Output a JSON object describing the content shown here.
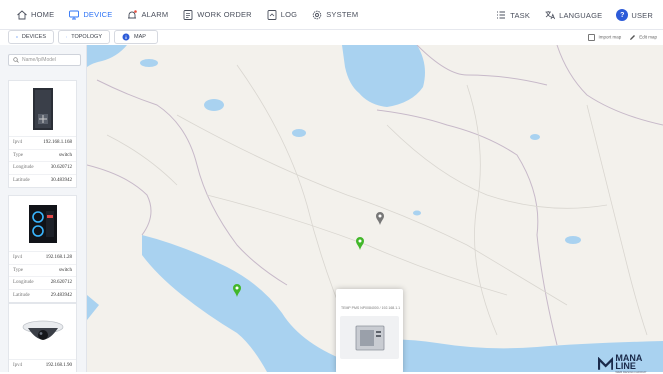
{
  "nav": {
    "items": [
      {
        "label": "HOME",
        "icon": "home-icon",
        "active": false
      },
      {
        "label": "DEVICE",
        "icon": "device-icon",
        "active": true
      },
      {
        "label": "ALARM",
        "icon": "alarm-icon",
        "active": false
      },
      {
        "label": "WORK ORDER",
        "icon": "work-order-icon",
        "active": false
      },
      {
        "label": "LOG",
        "icon": "log-icon",
        "active": false
      },
      {
        "label": "SYSTEM",
        "icon": "system-icon",
        "active": false
      }
    ],
    "right": {
      "task": "TASK",
      "language": "LANGUAGE",
      "user": "USER"
    },
    "accent": "#2d73f5"
  },
  "subtabs": {
    "devices": "DEVICES",
    "topology": "TOPOLOGY",
    "map": "MAP"
  },
  "map_tools": {
    "import": "Import map",
    "edit": "Edit map"
  },
  "search": {
    "placeholder": "Name/Ip/Model"
  },
  "devices": [
    {
      "rows": [
        {
          "k": "Ipv4",
          "v": "192.168.1.168"
        },
        {
          "k": "Type",
          "v": "switch"
        },
        {
          "k": "Longitude",
          "v": "30.620712"
        },
        {
          "k": "Latitude",
          "v": "30.483942"
        }
      ]
    },
    {
      "rows": [
        {
          "k": "Ipv4",
          "v": "192.168.1.28"
        },
        {
          "k": "Type",
          "v": "switch"
        },
        {
          "k": "Longitude",
          "v": "28.620712"
        },
        {
          "k": "Latitude",
          "v": "29.483942"
        }
      ]
    },
    {
      "rows": [
        {
          "k": "Ipv4",
          "v": "192.168.1.90"
        }
      ]
    }
  ],
  "popup": {
    "title": "TEMP PMS NP0084000 / 192.168.1.1"
  },
  "markers": [
    {
      "color": "#42b72a"
    },
    {
      "color": "#42b72a"
    },
    {
      "color": "#777777"
    }
  ],
  "logo": {
    "mark": "M",
    "name": "MANA LINE",
    "sub": "WEB DESIGN GROUP"
  },
  "colors": {
    "sea": "#a9d2f0",
    "land": "#f3f1ec",
    "border": "#c7b9c9"
  }
}
